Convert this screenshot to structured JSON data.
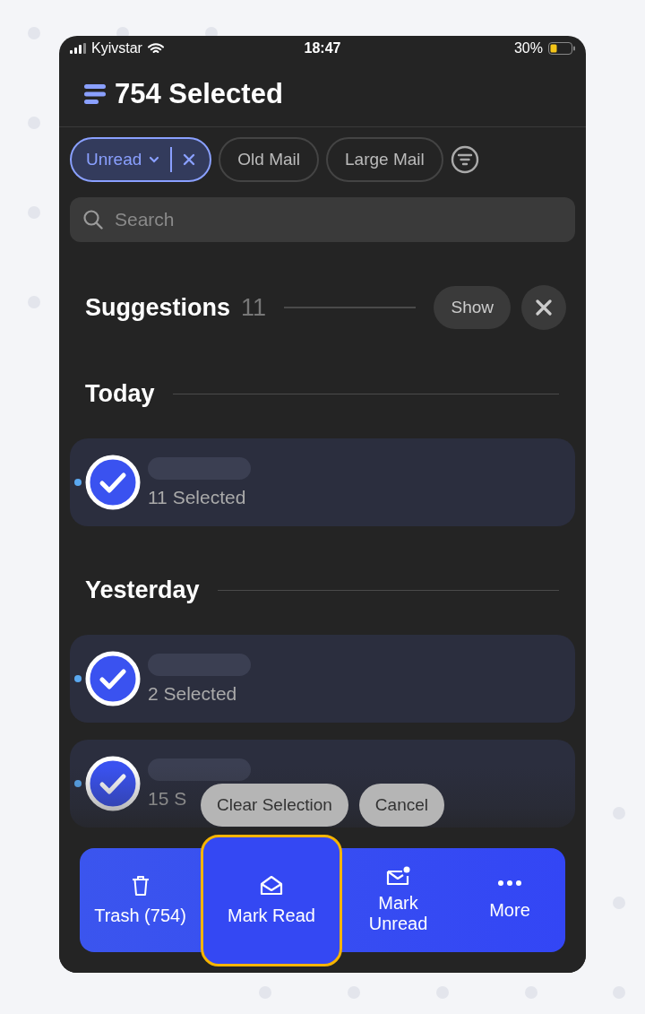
{
  "status_bar": {
    "carrier": "Kyivstar",
    "time": "18:47",
    "battery": "30%"
  },
  "header": {
    "title": "754 Selected"
  },
  "filters": [
    {
      "label": "Unread",
      "selected": true
    },
    {
      "label": "Old Mail",
      "selected": false
    },
    {
      "label": "Large Mail",
      "selected": false
    }
  ],
  "search": {
    "placeholder": "Search"
  },
  "suggestions": {
    "label": "Suggestions",
    "count": "11",
    "button": "Show"
  },
  "sections": [
    {
      "title": "Today",
      "groups": [
        {
          "subtitle": "11 Selected",
          "checked": true,
          "unread": true
        }
      ]
    },
    {
      "title": "Yesterday",
      "groups": [
        {
          "subtitle": "2 Selected",
          "checked": true,
          "unread": true
        },
        {
          "subtitle": "15 S",
          "checked": true,
          "unread": true
        }
      ]
    }
  ],
  "selection_actions": [
    "Clear Selection",
    "Cancel"
  ],
  "actions": [
    {
      "label": "Trash (754)",
      "kind": "trash",
      "selected": false
    },
    {
      "label": "Mark Read",
      "kind": "read",
      "selected": true
    },
    {
      "label": "Mark Unread",
      "kind": "unread",
      "selected": false
    },
    {
      "label": "More",
      "kind": "more",
      "selected": false
    }
  ]
}
